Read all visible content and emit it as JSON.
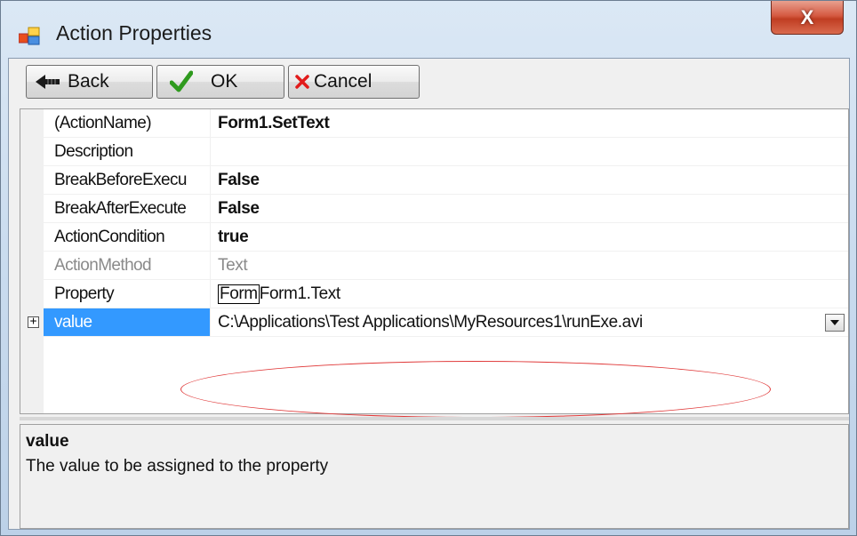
{
  "window": {
    "title": "Action Properties",
    "close_label": "X"
  },
  "toolbar": {
    "back_label": "Back",
    "ok_label": "OK",
    "cancel_label": "Cancel"
  },
  "properties": [
    {
      "name": "(ActionName)",
      "value": "Form1.SetText",
      "bold": true
    },
    {
      "name": "Description",
      "value": ""
    },
    {
      "name": "BreakBeforeExecu",
      "value": "False",
      "bold": true
    },
    {
      "name": "BreakAfterExecute",
      "value": "False",
      "bold": true
    },
    {
      "name": "ActionCondition",
      "value": "true",
      "bold": true
    },
    {
      "name": "ActionMethod",
      "value": "Text",
      "disabled": true
    },
    {
      "name": "Property",
      "value_edit": "Form",
      "value_rest": "Form1.Text"
    },
    {
      "name": "value",
      "value": "C:\\Applications\\Test Applications\\MyResources1\\runExe.avi",
      "selected": true,
      "expandable": true
    }
  ],
  "help": {
    "title": "value",
    "description": "The value to be assigned to the property"
  },
  "colors": {
    "selection": "#3399ff",
    "annotation": "#e03a3a"
  }
}
